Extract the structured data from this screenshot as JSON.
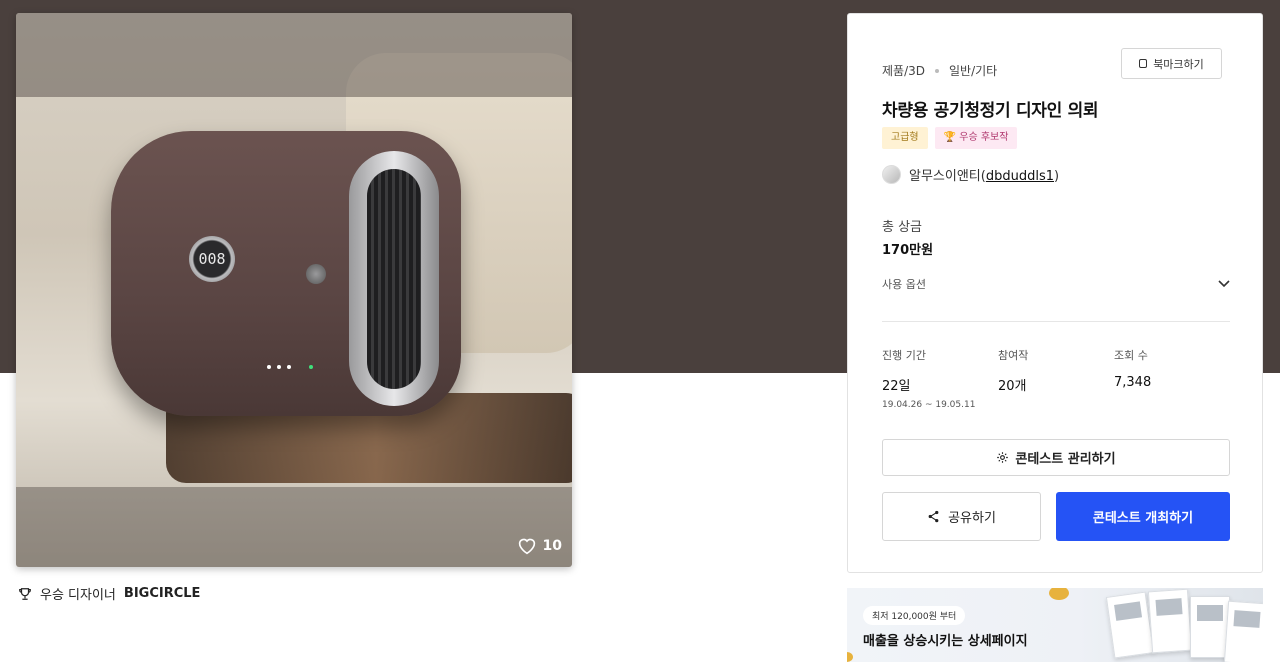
{
  "image": {
    "display_number": "008",
    "like_count": "10"
  },
  "designer": {
    "label": "우승 디자이너",
    "name": "BIGCIRCLE"
  },
  "card": {
    "breadcrumb": [
      "제품/3D",
      "일반/기타"
    ],
    "bookmark_label": "북마크하기",
    "title": "차량용 공기청정기 디자인 의뢰",
    "badges": [
      "고급형",
      "🏆 우승 후보작"
    ],
    "host_name": "알무스이앤티",
    "host_id": "dbduddls1",
    "prize_label": "총 상금",
    "prize_value": "170만원",
    "usage_label": "사용 옵션",
    "stats": [
      {
        "label": "진행 기간",
        "value": "22일",
        "sub": "19.04.26 ~ 19.05.11"
      },
      {
        "label": "참여작",
        "value": "20개"
      },
      {
        "label": "조회 수",
        "value": "7,348"
      }
    ],
    "manage_label": "콘테스트 관리하기",
    "share_label": "공유하기",
    "host_contest_label": "콘테스트 개최하기"
  },
  "ad": {
    "price_tag": "최저 120,000원 부터",
    "headline": "매출을 상승시키는 상세페이지"
  },
  "colors": {
    "hero_band": "#4a403d",
    "primary_button": "#2553f5"
  }
}
